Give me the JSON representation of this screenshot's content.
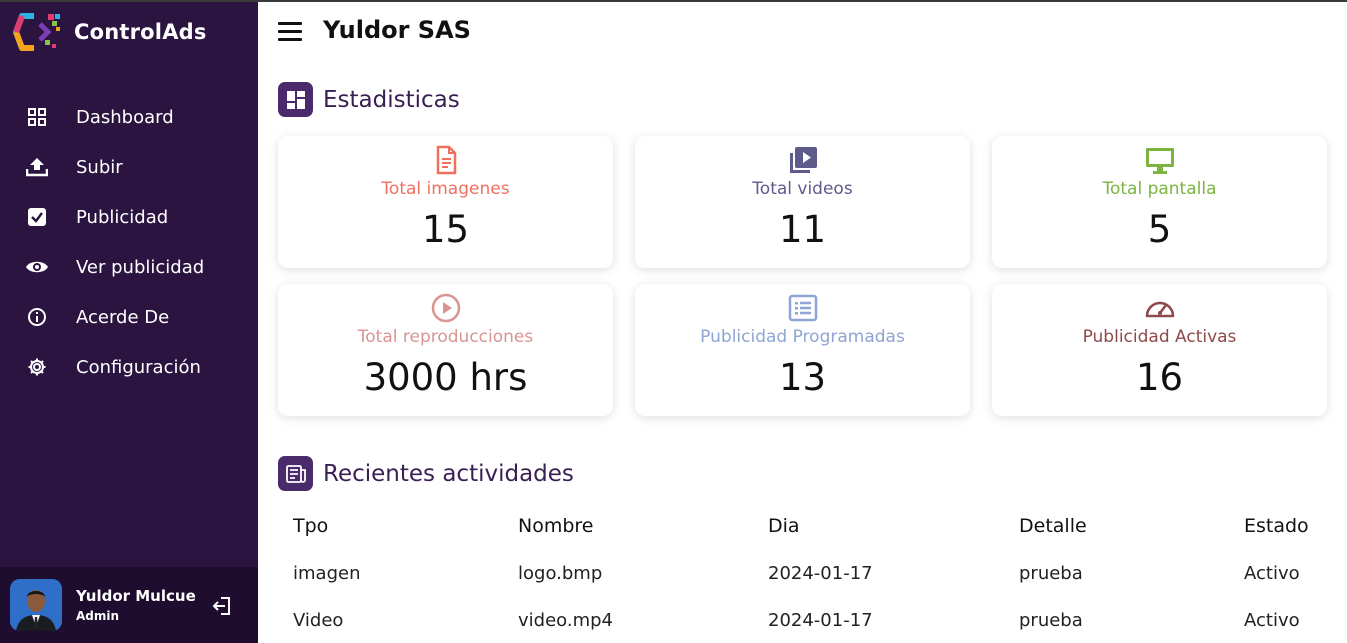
{
  "brand": {
    "name": "ControlAds"
  },
  "sidebar": {
    "items": [
      {
        "label": "Dashboard",
        "icon": "grid-icon"
      },
      {
        "label": "Subir",
        "icon": "upload-icon"
      },
      {
        "label": "Publicidad",
        "icon": "checkbox-icon"
      },
      {
        "label": "Ver publicidad",
        "icon": "eye-icon"
      },
      {
        "label": "Acerde De",
        "icon": "info-icon"
      },
      {
        "label": "Configuración",
        "icon": "gear-icon"
      }
    ]
  },
  "user": {
    "name": "Yuldor Mulcue",
    "role": "Admin"
  },
  "header": {
    "company": "Yuldor SAS"
  },
  "stats": {
    "title": "Estadisticas",
    "cards": [
      {
        "label": "Total imagenes",
        "value": "15",
        "color": "#f0705f",
        "icon": "document-icon"
      },
      {
        "label": "Total videos",
        "value": "11",
        "color": "#5e5a8c",
        "icon": "video-library-icon"
      },
      {
        "label": "Total pantalla",
        "value": "5",
        "color": "#7cb342",
        "icon": "monitor-icon"
      },
      {
        "label": "Total reproducciones",
        "value": "3000 hrs",
        "color": "#d99494",
        "icon": "play-circle-icon"
      },
      {
        "label": "Publicidad Programadas",
        "value": "13",
        "color": "#8ea4d2",
        "icon": "list-icon"
      },
      {
        "label": "Publicidad Activas",
        "value": "16",
        "color": "#8e4a4a",
        "icon": "speedometer-icon"
      }
    ]
  },
  "recent": {
    "title": "Recientes actividades",
    "columns": [
      "Tpo",
      "Nombre",
      "Dia",
      "Detalle",
      "Estado"
    ],
    "rows": [
      [
        "imagen",
        "logo.bmp",
        "2024-01-17",
        "prueba",
        "Activo"
      ],
      [
        "Video",
        "video.mp4",
        "2024-01-17",
        "prueba",
        "Activo"
      ]
    ]
  },
  "colors": {
    "sidebar": "#2b1540",
    "accent": "#4a2a6a"
  }
}
